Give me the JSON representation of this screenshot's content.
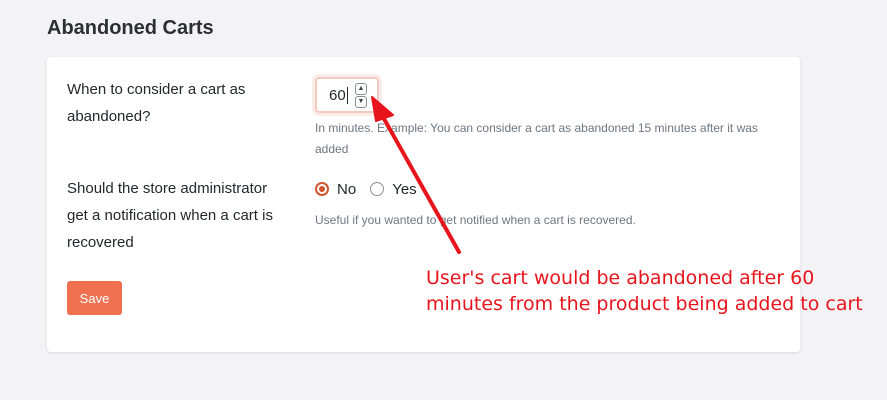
{
  "section": {
    "title": "Abandoned Carts"
  },
  "settings": {
    "abandon_time": {
      "label": "When to consider a cart as abandoned?",
      "value": "60",
      "help": "In minutes. Example: You can consider a cart as abandoned 15 minutes after it was added"
    },
    "admin_notify": {
      "label": "Should the store administrator get a notification when a cart is recovered",
      "options": [
        {
          "label": "No",
          "checked": true
        },
        {
          "label": "Yes",
          "checked": false
        }
      ],
      "help": "Useful if you wanted to get notified when a cart is recovered."
    }
  },
  "actions": {
    "save_label": "Save"
  },
  "annotation": {
    "text": "User's cart would be abandoned after 60 minutes from the product being added to cart",
    "color": "#e8141c"
  },
  "colors": {
    "accent": "#f07150",
    "radio_checked": "#d1542f"
  }
}
